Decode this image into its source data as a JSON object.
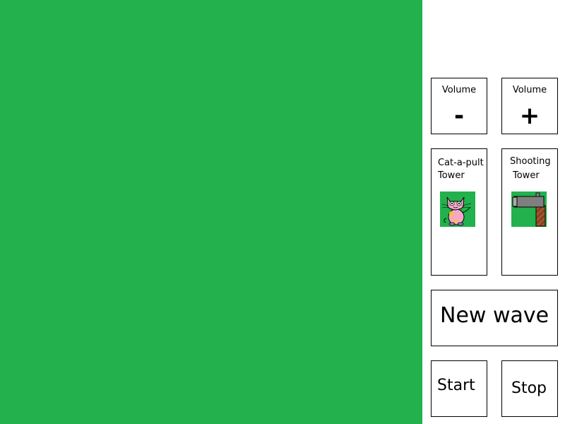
{
  "colors": {
    "field": "#22b14c",
    "panel": "#ffffff"
  },
  "volume": {
    "down": {
      "label": "Volume",
      "sign": "-",
      "icon": "minus-icon"
    },
    "up": {
      "label": "Volume",
      "sign": "+",
      "icon": "plus-icon"
    }
  },
  "towers": {
    "catapult": {
      "line1": "Cat-a-pult",
      "line2": "Tower",
      "icon": "cat-icon"
    },
    "shooting": {
      "line1": "Shooting",
      "line2": "Tower",
      "icon": "cannon-icon"
    }
  },
  "controls": {
    "new_wave": "New wave",
    "start": "Start",
    "stop": "Stop"
  }
}
